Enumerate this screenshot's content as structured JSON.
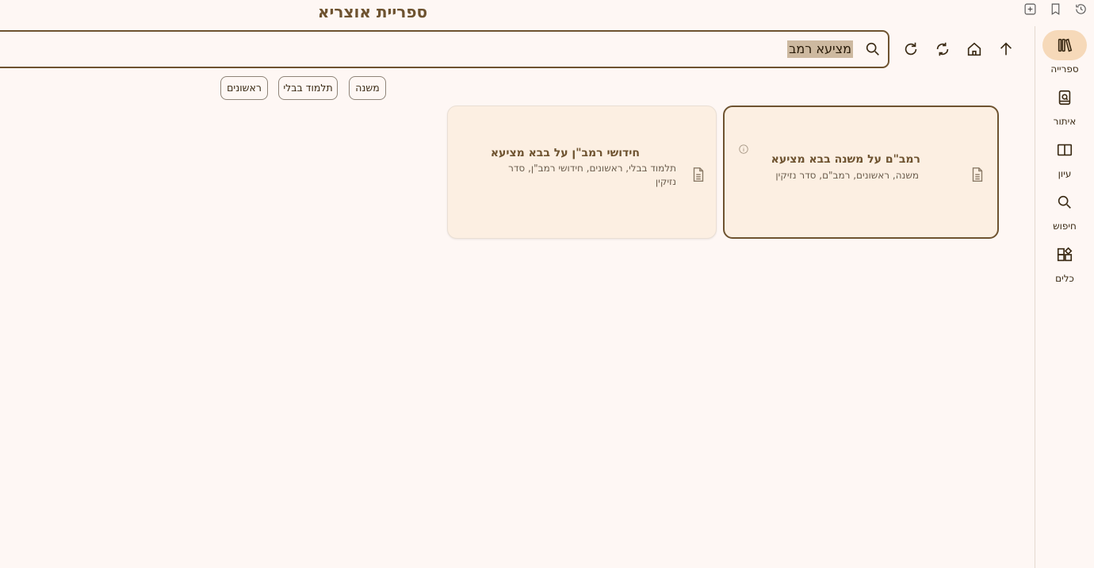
{
  "app": {
    "title": "ספריית אוצריא"
  },
  "topbar_icons": [
    "history-icon",
    "bookmark-icon",
    "add-tab-icon"
  ],
  "sidebar": {
    "items": [
      {
        "label": "ספרייה",
        "icon": "library-icon",
        "active": true
      },
      {
        "label": "איתור",
        "icon": "find-book-icon"
      },
      {
        "label": "עיון",
        "icon": "open-book-icon"
      },
      {
        "label": "חיפוש",
        "icon": "search-icon"
      },
      {
        "label": "כלים",
        "icon": "tools-icon"
      }
    ]
  },
  "toolbar": {
    "buttons": [
      "arrow-up-icon",
      "home-icon",
      "sync-icon",
      "refresh-icon"
    ]
  },
  "search": {
    "value": "מציעא רמב"
  },
  "filters": [
    "משנה",
    "תלמוד בבלי",
    "ראשונים"
  ],
  "results": [
    {
      "title": "רמב\"ם על משנה בבא מציעא",
      "subtitle": "משנה, ראשונים, רמב\"ם, סדר נזיקין",
      "selected": true
    },
    {
      "title": "חידושי רמב\"ן על בבא מציעא",
      "subtitle": "תלמוד בבלי, ראשונים, חידושי רמב\"ן, סדר נזיקין",
      "selected": false
    }
  ],
  "colors": {
    "background": "#fef7f4",
    "accent": "#6e5330",
    "active_nav": "#f6d9b9",
    "card": "#fcefe2",
    "highlight": "#cdb9a0"
  }
}
